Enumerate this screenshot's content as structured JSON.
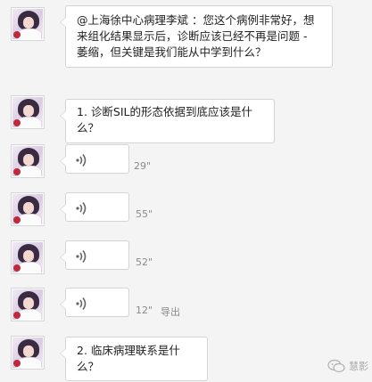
{
  "messages": [
    {
      "type": "text",
      "text": "@上海徐中心病理李斌 ：您这个病例非常好，想来组化结果显示后，诊断应该已经不再是问题 - 萎缩，但关键是我们能从中学到什么？"
    },
    {
      "type": "text",
      "text": "1. 诊断SIL的形态依据到底应该是什么？"
    },
    {
      "type": "voice",
      "duration": "29\""
    },
    {
      "type": "voice",
      "duration": "55\""
    },
    {
      "type": "voice",
      "duration": "52\""
    },
    {
      "type": "voice",
      "duration": "12\"",
      "action": "导出"
    },
    {
      "type": "text",
      "text": "2. 临床病理联系是什么？"
    }
  ],
  "icons": {
    "avatar": "avatar-icon",
    "voice": "voice-wave-icon",
    "watermark": "wechat-logo-icon"
  },
  "watermark": {
    "text": "慧影"
  },
  "colors": {
    "background": "#f4f4f4",
    "bubble": "#ffffff",
    "bubble_border": "#d4d4d4",
    "meta_text": "#8a8a8a"
  }
}
